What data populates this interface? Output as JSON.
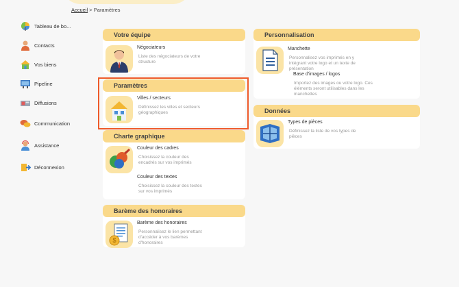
{
  "breadcrumb": {
    "home": "Accueil",
    "separator": ">",
    "current": "Paramètres"
  },
  "sidebar": {
    "items": [
      {
        "label": "Tableau de bo...",
        "icon": "dashboard-icon"
      },
      {
        "label": "Contacts",
        "icon": "person-icon"
      },
      {
        "label": "Vos biens",
        "icon": "house-icon"
      },
      {
        "label": "Pipeline",
        "icon": "pipeline-icon"
      },
      {
        "label": "Diffusions",
        "icon": "broadcast-icon"
      },
      {
        "label": "Communication",
        "icon": "chat-icon"
      },
      {
        "label": "Assistance",
        "icon": "support-icon"
      },
      {
        "label": "Déconnexion",
        "icon": "logout-icon"
      }
    ]
  },
  "sections": {
    "equipe": {
      "title": "Votre équipe",
      "items": [
        {
          "title": "Négociateurs",
          "desc": "Liste des négociateurs de votre structure",
          "icon": "negotiator-icon"
        }
      ]
    },
    "parametres": {
      "title": "Paramètres",
      "items": [
        {
          "title": "Villes / secteurs",
          "desc": "Définissez les villes et secteurs géographiques",
          "icon": "city-icon"
        }
      ]
    },
    "charte": {
      "title": "Charte graphique",
      "items": [
        {
          "title": "Couleur des cadres",
          "desc": "Choisissez la couleur des encadrés sur vos imprimés",
          "icon": "palette-icon"
        },
        {
          "title": "Couleur des textes",
          "desc": "Choisissez la couleur des textes sur vos imprimés",
          "icon": ""
        }
      ]
    },
    "bareme": {
      "title": "Barème des honoraires",
      "items": [
        {
          "title": "Barème des honoraires",
          "desc": "Personnalisez le lien permettant d'accéder à vos barèmes d'honoraires",
          "icon": "fee-scale-icon"
        }
      ]
    },
    "perso": {
      "title": "Personnalisation",
      "items": [
        {
          "title": "Manchette",
          "desc": "Personnalisez vos imprimés en y intégrant votre logo et un texte de présentation",
          "icon": "document-icon"
        },
        {
          "title": "Base d'images / logos",
          "desc": "Importez des images ou votre logo. Ces éléments seront utilisables dans les manchettes",
          "icon": ""
        }
      ]
    },
    "donnees": {
      "title": "Données",
      "items": [
        {
          "title": "Types de pièces",
          "desc": "Définissez la liste de vos types de pièces",
          "icon": "room-types-icon"
        }
      ]
    }
  }
}
